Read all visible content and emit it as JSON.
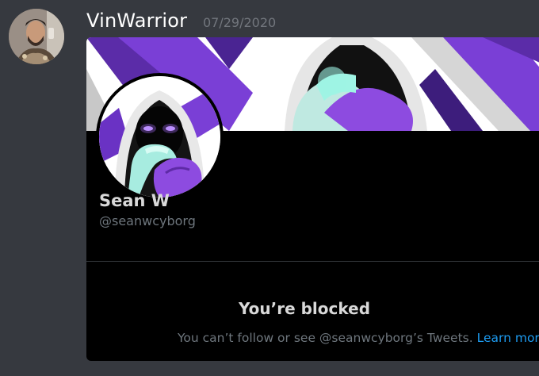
{
  "message": {
    "username": "VinWarrior",
    "timestamp": "07/29/2020",
    "avatar_icon": "user-avatar-icon"
  },
  "embed": {
    "display_name": "Sean W",
    "handle": "@seanwcyborg",
    "blocked_title": "You’re blocked",
    "blocked_desc": "You can’t follow or see @seanwcyborg’s Tweets.",
    "learn_more": "Learn more"
  },
  "colors": {
    "background": "#36393f",
    "embed_bg": "#000000",
    "accent_purple": "#7a3fd6",
    "accent_teal": "#8fe8d8",
    "link": "#1d9bf0"
  }
}
